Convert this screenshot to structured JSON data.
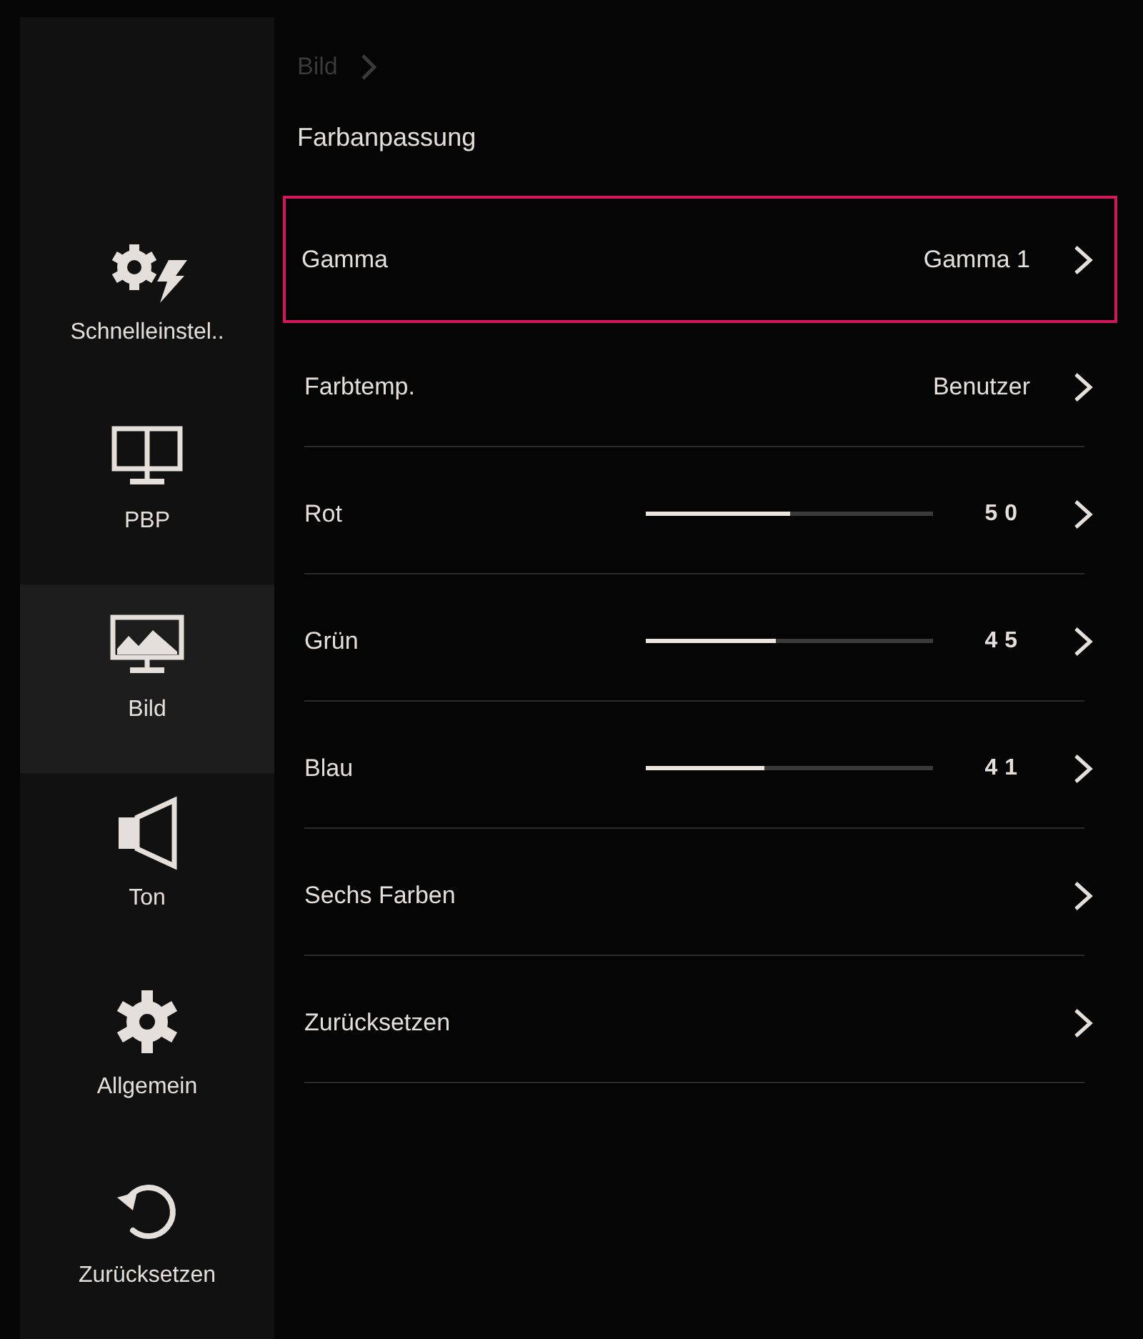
{
  "sidebar": {
    "items": [
      {
        "label": "Schnelleinstel..",
        "selected": false
      },
      {
        "label": "PBP",
        "selected": false
      },
      {
        "label": "Bild",
        "selected": true
      },
      {
        "label": "Ton",
        "selected": false
      },
      {
        "label": "Allgemein",
        "selected": false
      },
      {
        "label": "Zurücksetzen",
        "selected": false
      }
    ]
  },
  "breadcrumb": {
    "label": "Bild"
  },
  "title": "Farbanpassung",
  "rows": [
    {
      "kind": "option",
      "label": "Gamma",
      "value": "Gamma 1",
      "selected": true
    },
    {
      "kind": "option",
      "label": "Farbtemp.",
      "value": "Benutzer",
      "selected": false
    },
    {
      "kind": "slider",
      "label": "Rot",
      "level": 0.5,
      "reading": "50",
      "selected": false
    },
    {
      "kind": "slider",
      "label": "Grün",
      "level": 0.45,
      "reading": "45",
      "selected": false
    },
    {
      "kind": "slider",
      "label": "Blau",
      "level": 0.41,
      "reading": "41",
      "selected": false
    },
    {
      "kind": "link",
      "label": "Sechs Farben",
      "selected": false
    },
    {
      "kind": "link",
      "label": "Zurücksetzen",
      "selected": false
    }
  ]
}
